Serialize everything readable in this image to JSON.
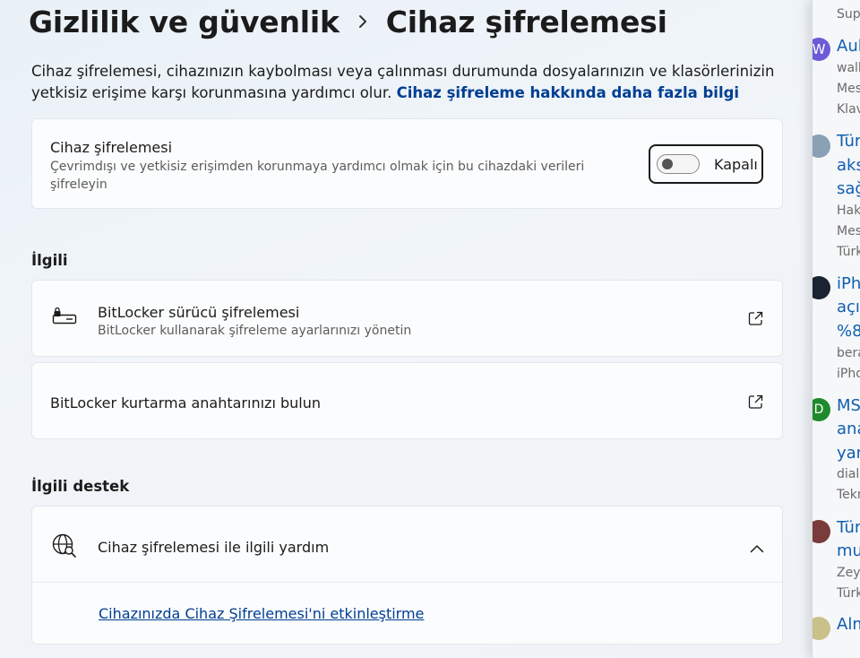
{
  "breadcrumb": {
    "parent": "Gizlilik ve güvenlik",
    "current": "Cihaz şifrelemesi"
  },
  "description": {
    "text": "Cihaz şifrelemesi, cihazınızın kaybolması veya çalınması durumunda dosyalarınızın ve klasörlerinizin yetkisiz erişime karşı korunmasına yardımcı olur.",
    "link": "Cihaz şifreleme hakkında daha fazla bilgi"
  },
  "encryption_card": {
    "title": "Cihaz şifrelemesi",
    "subtitle": "Çevrimdışı ve yetkisiz erişimden korunmaya yardımcı olmak için bu cihazdaki verileri şifreleyin",
    "toggle_state": "Kapalı",
    "toggle_on": false
  },
  "related": {
    "title": "İlgili",
    "items": [
      {
        "title": "BitLocker sürücü şifrelemesi",
        "subtitle": "BitLocker kullanarak şifreleme ayarlarınızı yönetin",
        "icon": "drive-lock-icon"
      },
      {
        "title": "BitLocker kurtarma anahtarınızı bulun",
        "icon": "external-link-icon"
      }
    ]
  },
  "related_support": {
    "title": "İlgili destek",
    "item_title": "Cihaz şifrelemesi ile ilgili yardım",
    "item_icon": "globe-search-icon",
    "link": "Cihazınızda Cihaz Şifrelemesi'ni etkinleştirme"
  },
  "side_panel": {
    "header": "Sup",
    "entries": [
      {
        "title_lines": [
          "Aul"
        ],
        "meta_lines": [
          "wall",
          "Mes",
          "Klav"
        ],
        "avatar_letter": "W",
        "avatar_color": "#6b5bd6"
      },
      {
        "title_lines": [
          "Tür",
          "aks",
          "sağ"
        ],
        "meta_lines": [
          "Hak",
          "Mes",
          "Türk"
        ],
        "avatar_color": "#8aa0b5"
      },
      {
        "title_lines": [
          "iPh",
          "açıl",
          "%8"
        ],
        "meta_lines": [
          "bera",
          "iPho"
        ],
        "avatar_color": "#1a2330"
      },
      {
        "title_lines": [
          "MS",
          "ana",
          "yan"
        ],
        "meta_lines": [
          "dial",
          "Tekn"
        ],
        "avatar_letter": "D",
        "avatar_color": "#1f8a2c"
      },
      {
        "title_lines": [
          "Tür",
          "mu"
        ],
        "meta_lines": [
          "Zey",
          "Türk"
        ],
        "avatar_color": "#7a3b3b"
      },
      {
        "title_lines": [
          "Alm"
        ],
        "meta_lines": [],
        "avatar_color": "#c9c08a"
      }
    ]
  },
  "colors": {
    "accent_link": "#003e92",
    "side_title": "#0f5fb0"
  }
}
